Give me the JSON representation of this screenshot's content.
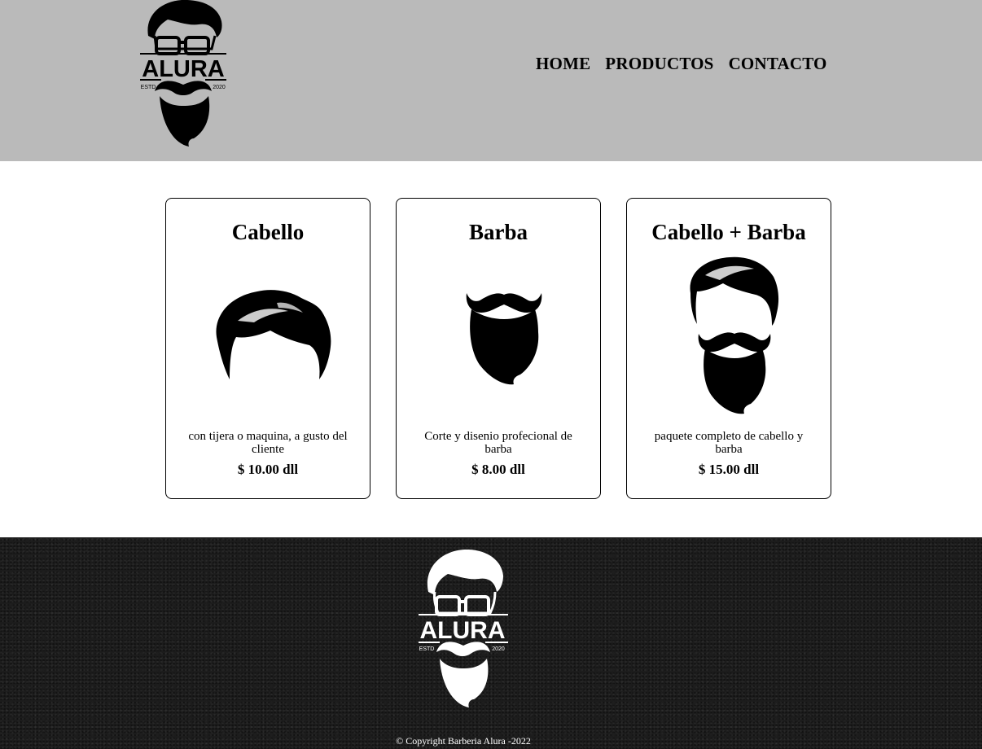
{
  "header": {
    "logo": {
      "text": "ALURA",
      "est": "ESTD",
      "year": "2020"
    },
    "nav": [
      {
        "label": "HOME"
      },
      {
        "label": "PRODUCTOS"
      },
      {
        "label": "CONTACTO"
      }
    ]
  },
  "products": [
    {
      "title": "Cabello",
      "description": "con tijera o maquina, a gusto del cliente",
      "price": "$ 10.00 dll",
      "icon": "hair-icon"
    },
    {
      "title": "Barba",
      "description": "Corte y disenio profecional de barba",
      "price": "$ 8.00 dll",
      "icon": "beard-icon"
    },
    {
      "title": "Cabello + Barba",
      "description": "paquete completo de cabello y barba",
      "price": "$ 15.00 dll",
      "icon": "hair-and-beard-icon"
    }
  ],
  "footer": {
    "logo": {
      "text": "ALURA",
      "est": "ESTD",
      "year": "2020"
    },
    "copyright": "© Copyright Barberia Alura -2022"
  },
  "colors": {
    "header_bg": "#bababa",
    "footer_bg": "#1c1c1c",
    "text": "#000000"
  }
}
